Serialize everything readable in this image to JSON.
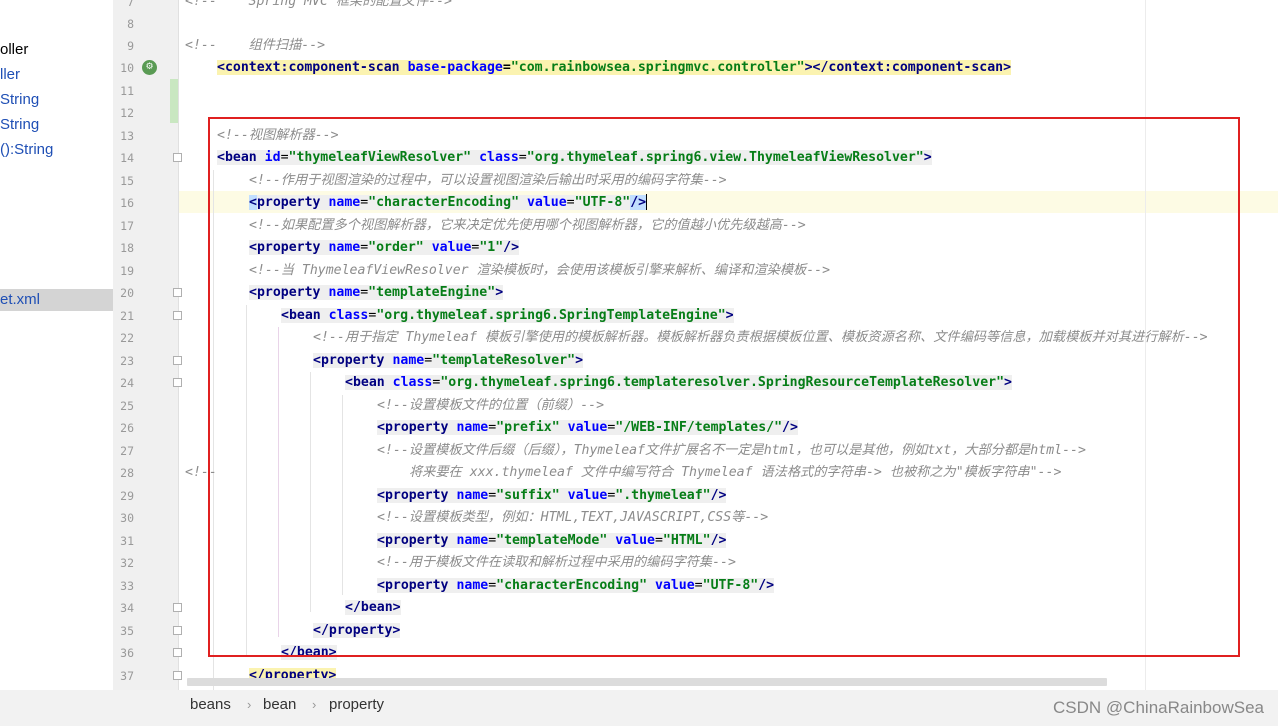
{
  "sidebar": {
    "items": [
      {
        "label": "oller",
        "style": "black"
      },
      {
        "label": "ller",
        "style": "blue"
      },
      {
        "label": "String",
        "style": "blue"
      },
      {
        "label": "String",
        "style": "blue"
      },
      {
        "label": "():String",
        "style": "blue"
      },
      {
        "label": "et.xml",
        "style": "selected"
      }
    ]
  },
  "gutter": {
    "line_numbers": [
      "7",
      "8",
      "9",
      "10",
      "11",
      "12",
      "13",
      "14",
      "15",
      "16",
      "17",
      "18",
      "19",
      "20",
      "21",
      "22",
      "23",
      "24",
      "25",
      "26",
      "27",
      "28",
      "29",
      "30",
      "31",
      "32",
      "33",
      "34",
      "35",
      "36",
      "37"
    ]
  },
  "code": {
    "l7": "<!--    Spring MVC 框架的配置文件-->",
    "l9": "<!--    组件扫描-->",
    "l10_tag": "context:component-scan",
    "l10_attr": "base-package",
    "l10_val": "\"com.rainbowsea.springmvc.controller\"",
    "l13": "<!--视图解析器-->",
    "l14_id": "\"thymeleafViewResolver\"",
    "l14_class": "\"org.thymeleaf.spring6.view.ThymeleafViewResolver\"",
    "l15": "<!--作用于视图渲染的过程中，可以设置视图渲染后输出时采用的编码字符集-->",
    "l16_name": "\"characterEncoding\"",
    "l16_value": "\"UTF-8\"",
    "l17": "<!--如果配置多个视图解析器，它来决定优先使用哪个视图解析器，它的值越小优先级越高-->",
    "l18_name": "\"order\"",
    "l18_value": "\"1\"",
    "l19": "<!--当 ThymeleafViewResolver 渲染模板时，会使用该模板引擎来解析、编译和渲染模板-->",
    "l20_name": "\"templateEngine\"",
    "l21_class": "\"org.thymeleaf.spring6.SpringTemplateEngine\"",
    "l22": "<!--用于指定 Thymeleaf 模板引擎使用的模板解析器。模板解析器负责根据模板位置、模板资源名称、文件编码等信息，加载模板并对其进行解析-->",
    "l23_name": "\"templateResolver\"",
    "l24_class": "\"org.thymeleaf.spring6.templateresolver.SpringResourceTemplateResolver\"",
    "l25": "<!--设置模板文件的位置（前缀）-->",
    "l26_name": "\"prefix\"",
    "l26_value": "\"/WEB-INF/templates/\"",
    "l27": "<!--设置模板文件后缀（后缀），Thymeleaf文件扩展名不一定是html，也可以是其他，例如txt，大部分都是html-->",
    "l28a": "<!--",
    "l28b": "将来要在 xxx.thymeleaf 文件中编写符合 Thymeleaf 语法格式的字符串-> 也被称之为\"模板字符串\"-->",
    "l29_name": "\"suffix\"",
    "l29_value": "\".thymeleaf\"",
    "l30": "<!--设置模板类型，例如：HTML,TEXT,JAVASCRIPT,CSS等-->",
    "l31_name": "\"templateMode\"",
    "l31_value": "\"HTML\"",
    "l32": "<!--用于模板文件在读取和解析过程中采用的编码字符集-->",
    "l33_name": "\"characterEncoding\"",
    "l33_value": "\"UTF-8\"",
    "kw_bean": "bean",
    "kw_property": "property",
    "kw_id": "id",
    "kw_class": "class",
    "kw_name": "name",
    "kw_value": "value"
  },
  "breadcrumb": [
    "beans",
    "bean",
    "property"
  ],
  "watermark": "CSDN @ChinaRainbowSea",
  "colors": {
    "comment": "#8c8c8c",
    "tag": "#000080",
    "attr": "#0000ff",
    "value": "#067d17",
    "highlight_box": "#e02020"
  }
}
